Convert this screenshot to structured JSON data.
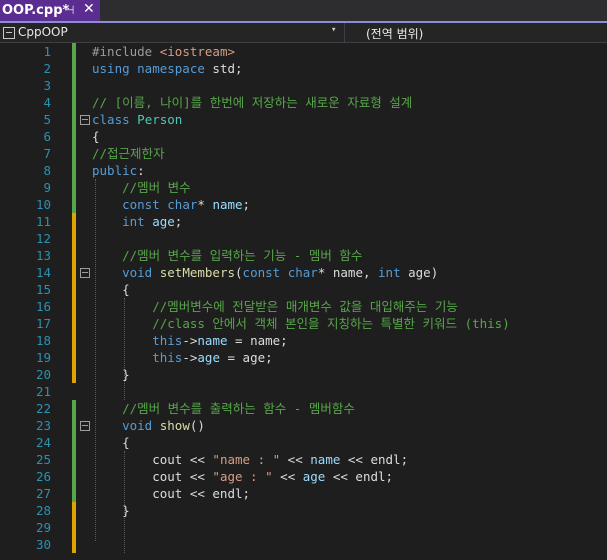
{
  "tab": {
    "title": "OOP.cpp*",
    "pin": "⊣",
    "close": "✕"
  },
  "nav": {
    "project": "CppOOP",
    "dropdown": "▾",
    "scope": "(전역 범위)"
  },
  "lines": [
    {
      "n": "1",
      "bar": "saved",
      "segs": [
        {
          "c": "pp",
          "t": "#include"
        },
        {
          "c": "",
          "t": " "
        },
        {
          "c": "st",
          "t": "<iostream>"
        }
      ]
    },
    {
      "n": "2",
      "bar": "saved",
      "segs": [
        {
          "c": "kw",
          "t": "using namespace"
        },
        {
          "c": "",
          "t": " std;"
        }
      ]
    },
    {
      "n": "3",
      "bar": "saved",
      "segs": []
    },
    {
      "n": "4",
      "bar": "saved",
      "segs": [
        {
          "c": "cm",
          "t": "// [이름, 나이]를 한번에 저장하는 새로운 자료형 설계"
        }
      ]
    },
    {
      "n": "5",
      "bar": "saved",
      "fold": true,
      "segs": [
        {
          "c": "kw",
          "t": "class"
        },
        {
          "c": "",
          "t": " "
        },
        {
          "c": "ty",
          "t": "Person"
        }
      ]
    },
    {
      "n": "6",
      "bar": "saved",
      "segs": [
        {
          "c": "",
          "t": "{"
        }
      ]
    },
    {
      "n": "7",
      "bar": "saved",
      "segs": [
        {
          "c": "cm",
          "t": "//접근제한자"
        }
      ]
    },
    {
      "n": "8",
      "bar": "saved",
      "segs": [
        {
          "c": "kw",
          "t": "public"
        },
        {
          "c": "",
          "t": ":"
        }
      ]
    },
    {
      "n": "9",
      "bar": "saved",
      "segs": [
        {
          "c": "",
          "t": "    "
        },
        {
          "c": "cm",
          "t": "//멤버 변수"
        }
      ]
    },
    {
      "n": "10",
      "bar": "saved",
      "segs": [
        {
          "c": "",
          "t": "    "
        },
        {
          "c": "kw",
          "t": "const char"
        },
        {
          "c": "",
          "t": "* "
        },
        {
          "c": "pr",
          "t": "name"
        },
        {
          "c": "",
          "t": ";"
        }
      ]
    },
    {
      "n": "11",
      "bar": "unsaved",
      "segs": [
        {
          "c": "",
          "t": "    "
        },
        {
          "c": "kw",
          "t": "int"
        },
        {
          "c": "",
          "t": " "
        },
        {
          "c": "pr",
          "t": "age"
        },
        {
          "c": "",
          "t": ";"
        }
      ]
    },
    {
      "n": "12",
      "bar": "unsaved",
      "segs": []
    },
    {
      "n": "13",
      "bar": "unsaved",
      "segs": [
        {
          "c": "",
          "t": "    "
        },
        {
          "c": "cm",
          "t": "//멤버 변수를 입력하는 기능 - 멤버 함수"
        }
      ]
    },
    {
      "n": "14",
      "bar": "unsaved",
      "fold": true,
      "segs": [
        {
          "c": "",
          "t": "    "
        },
        {
          "c": "kw",
          "t": "void"
        },
        {
          "c": "",
          "t": " "
        },
        {
          "c": "fn",
          "t": "setMembers"
        },
        {
          "c": "",
          "t": "("
        },
        {
          "c": "kw",
          "t": "const char"
        },
        {
          "c": "",
          "t": "* name, "
        },
        {
          "c": "kw",
          "t": "int"
        },
        {
          "c": "",
          "t": " age)"
        }
      ]
    },
    {
      "n": "15",
      "bar": "unsaved",
      "segs": [
        {
          "c": "",
          "t": "    {"
        }
      ]
    },
    {
      "n": "16",
      "bar": "unsaved",
      "segs": [
        {
          "c": "",
          "t": "        "
        },
        {
          "c": "cm",
          "t": "//멤버변수에 전달받은 매개변수 값을 대입해주는 기능"
        }
      ]
    },
    {
      "n": "17",
      "bar": "unsaved",
      "segs": [
        {
          "c": "",
          "t": "        "
        },
        {
          "c": "cm",
          "t": "//class 안에서 객체 본인을 지칭하는 특별한 키워드 (this)"
        }
      ]
    },
    {
      "n": "18",
      "bar": "unsaved",
      "segs": [
        {
          "c": "",
          "t": "        "
        },
        {
          "c": "kw",
          "t": "this"
        },
        {
          "c": "",
          "t": "->"
        },
        {
          "c": "pr",
          "t": "name"
        },
        {
          "c": "",
          "t": " = name;"
        }
      ]
    },
    {
      "n": "19",
      "bar": "unsaved",
      "segs": [
        {
          "c": "",
          "t": "        "
        },
        {
          "c": "kw",
          "t": "this"
        },
        {
          "c": "",
          "t": "->"
        },
        {
          "c": "pr",
          "t": "age"
        },
        {
          "c": "",
          "t": " = age;"
        }
      ]
    },
    {
      "n": "20",
      "bar": "unsaved",
      "segs": [
        {
          "c": "",
          "t": "    }"
        }
      ]
    },
    {
      "n": "21",
      "bar": "none",
      "segs": []
    },
    {
      "n": "22",
      "bar": "saved",
      "segs": [
        {
          "c": "",
          "t": "    "
        },
        {
          "c": "cm",
          "t": "//멤버 변수를 출력하는 함수 - 멤버함수"
        }
      ]
    },
    {
      "n": "23",
      "bar": "saved",
      "fold": true,
      "segs": [
        {
          "c": "",
          "t": "    "
        },
        {
          "c": "kw",
          "t": "void"
        },
        {
          "c": "",
          "t": " "
        },
        {
          "c": "fn",
          "t": "show"
        },
        {
          "c": "",
          "t": "()"
        }
      ]
    },
    {
      "n": "24",
      "bar": "saved",
      "segs": [
        {
          "c": "",
          "t": "    {"
        }
      ]
    },
    {
      "n": "25",
      "bar": "saved",
      "segs": [
        {
          "c": "",
          "t": "        cout << "
        },
        {
          "c": "st",
          "t": "\"name : \""
        },
        {
          "c": "",
          "t": " << "
        },
        {
          "c": "pr",
          "t": "name"
        },
        {
          "c": "",
          "t": " << endl;"
        }
      ]
    },
    {
      "n": "26",
      "bar": "saved",
      "segs": [
        {
          "c": "",
          "t": "        cout << "
        },
        {
          "c": "st",
          "t": "\"age : \""
        },
        {
          "c": "",
          "t": " << "
        },
        {
          "c": "pr",
          "t": "age"
        },
        {
          "c": "",
          "t": " << endl;"
        }
      ]
    },
    {
      "n": "27",
      "bar": "saved",
      "segs": [
        {
          "c": "",
          "t": "        cout << endl;"
        }
      ]
    },
    {
      "n": "28",
      "bar": "unsaved",
      "segs": [
        {
          "c": "",
          "t": "    }"
        }
      ]
    },
    {
      "n": "29",
      "bar": "unsaved",
      "segs": []
    },
    {
      "n": "30",
      "bar": "unsaved",
      "segs": []
    }
  ]
}
